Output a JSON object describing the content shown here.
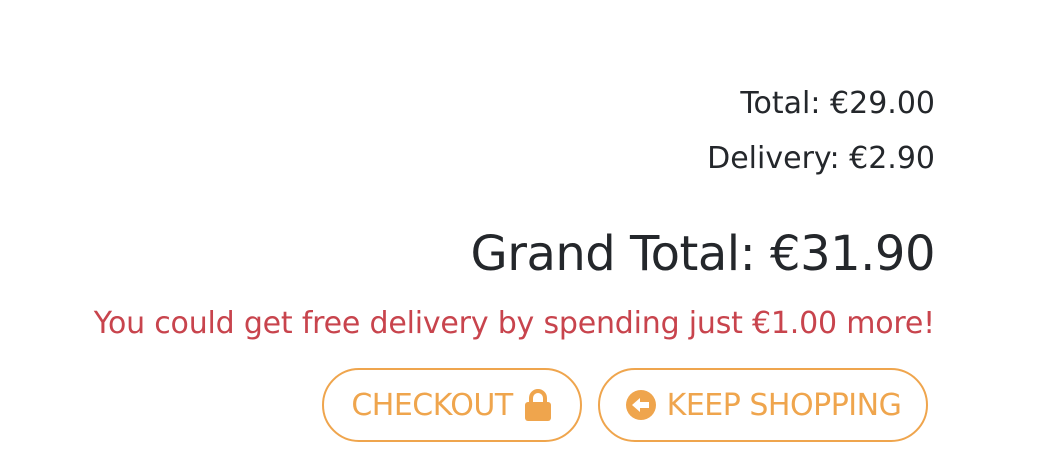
{
  "summary": {
    "total_text": "Total: €29.00",
    "delivery_text": "Delivery: €2.90",
    "grand_total_text": "Grand Total: €31.90",
    "free_delivery_message": "You could get free delivery by spending just €1.00 more!"
  },
  "actions": {
    "checkout_label": "CHECKOUT",
    "checkout_icon": "lock-icon",
    "keep_shopping_label": "KEEP SHOPPING",
    "keep_shopping_icon": "arrow-circle-left-icon"
  },
  "colors": {
    "text": "#24272b",
    "warning": "#c8444d",
    "accent": "#efa54d"
  }
}
